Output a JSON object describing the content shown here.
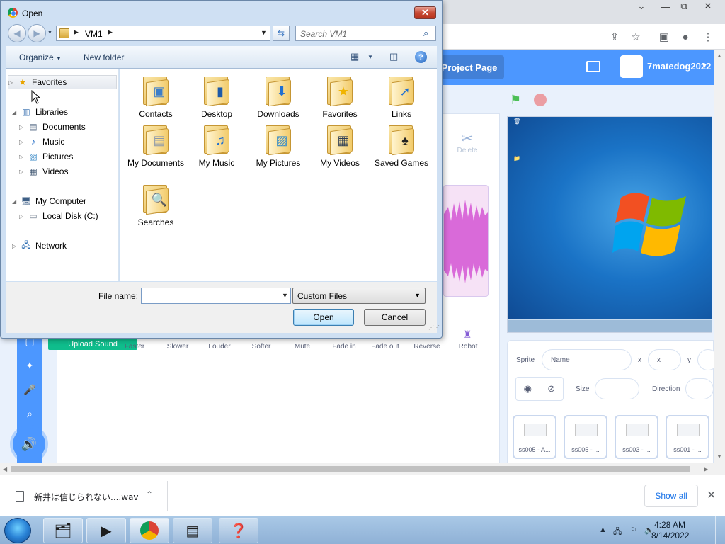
{
  "browser": {
    "minimize": "⌄",
    "restore": "⧉",
    "close": "✕"
  },
  "scratch": {
    "project_page_label": "Project Page",
    "username": "7matedog2022",
    "delete_label": "Delete",
    "effects": [
      "Faster",
      "Slower",
      "Louder",
      "Softer",
      "Mute",
      "Fade in",
      "Fade out",
      "Reverse",
      "Robot"
    ],
    "upload_label": "Upload Sound",
    "sprite_label": "Sprite",
    "sprite_name_placeholder": "Name",
    "x_label": "x",
    "x_placeholder": "x",
    "y_label": "y",
    "size_label": "Size",
    "direction_label": "Direction",
    "sprites": [
      "ss005 - A...",
      "ss005 - ...",
      "ss003 - ...",
      "ss001 - ..."
    ]
  },
  "download": {
    "file_name": "新井は信じられない....wav",
    "show_all": "Show all"
  },
  "taskbar": {
    "time": "4:28 AM",
    "date": "8/14/2022"
  },
  "dialog": {
    "title": "Open",
    "address": "VM1",
    "search_placeholder": "Search VM1",
    "organize": "Organize",
    "new_folder": "New folder",
    "nav": [
      {
        "label": "Favorites",
        "icon": "star-icon",
        "indent": 0,
        "arrow": "▷",
        "selected": true
      },
      {
        "label": "Libraries",
        "icon": "libraries-icon",
        "indent": 0,
        "arrow": "◢"
      },
      {
        "label": "Documents",
        "icon": "documents-icon",
        "indent": 1,
        "arrow": "▷"
      },
      {
        "label": "Music",
        "icon": "music-icon",
        "indent": 1,
        "arrow": "▷"
      },
      {
        "label": "Pictures",
        "icon": "pictures-icon",
        "indent": 1,
        "arrow": "▷"
      },
      {
        "label": "Videos",
        "icon": "videos-icon",
        "indent": 1,
        "arrow": "▷"
      },
      {
        "label": "My Computer",
        "icon": "computer-icon",
        "indent": 0,
        "arrow": "◢"
      },
      {
        "label": "Local Disk (C:)",
        "icon": "disk-icon",
        "indent": 1,
        "arrow": "▷"
      },
      {
        "label": "Network",
        "icon": "network-icon",
        "indent": 0,
        "arrow": "▷"
      }
    ],
    "folders": [
      {
        "label": "Contacts",
        "icon": "contacts-icon"
      },
      {
        "label": "Desktop",
        "icon": "desktop-icon"
      },
      {
        "label": "Downloads",
        "icon": "downloads-icon"
      },
      {
        "label": "Favorites",
        "icon": "favorites-star-icon"
      },
      {
        "label": "Links",
        "icon": "links-icon"
      },
      {
        "label": "My Documents",
        "icon": "my-documents-icon"
      },
      {
        "label": "My Music",
        "icon": "my-music-icon"
      },
      {
        "label": "My Pictures",
        "icon": "my-pictures-icon"
      },
      {
        "label": "My Videos",
        "icon": "my-videos-icon"
      },
      {
        "label": "Saved Games",
        "icon": "saved-games-icon"
      },
      {
        "label": "Searches",
        "icon": "searches-icon"
      }
    ],
    "file_name_label": "File name:",
    "file_name_value": "",
    "file_type": "Custom Files",
    "open_button": "Open",
    "cancel_button": "Cancel"
  }
}
